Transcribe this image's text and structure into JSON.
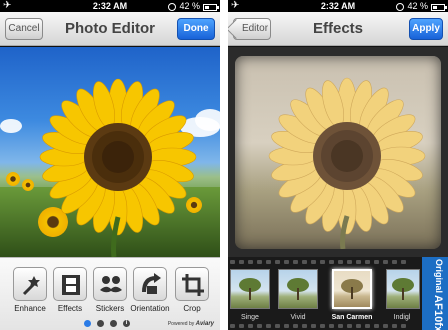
{
  "left_screen": {
    "status": {
      "time": "2:32 AM",
      "battery_text": "42 %",
      "battery_level": 0.42
    },
    "nav": {
      "cancel_label": "Cancel",
      "title": "Photo Editor",
      "done_label": "Done"
    },
    "tools": [
      {
        "label": "Enhance",
        "icon": "wand-sparkle-icon"
      },
      {
        "label": "Effects",
        "icon": "film-strip-icon"
      },
      {
        "label": "Stickers",
        "icon": "mustache-glasses-icon"
      },
      {
        "label": "Orientation",
        "icon": "rotate-arrow-icon"
      },
      {
        "label": "Crop",
        "icon": "crop-icon"
      }
    ],
    "page_dots": {
      "count": 3,
      "active_index": 0,
      "info": "i"
    },
    "powered_by": {
      "prefix": "Powered by",
      "brand": "Aviary"
    }
  },
  "right_screen": {
    "status": {
      "time": "2:32 AM",
      "battery_text": "42 %",
      "battery_level": 0.42
    },
    "nav": {
      "back_label": "Editor",
      "title": "Effects",
      "apply_label": "Apply"
    },
    "effects": [
      {
        "label": "Singe"
      },
      {
        "label": "Vivid"
      },
      {
        "label": "San Carmen",
        "selected": true
      },
      {
        "label": "Indigl"
      }
    ],
    "side_labels": [
      "Original",
      "AF",
      "10fx"
    ]
  },
  "colors": {
    "accent_blue": "#1862d8",
    "panel_blue": "#1c6ec4"
  }
}
